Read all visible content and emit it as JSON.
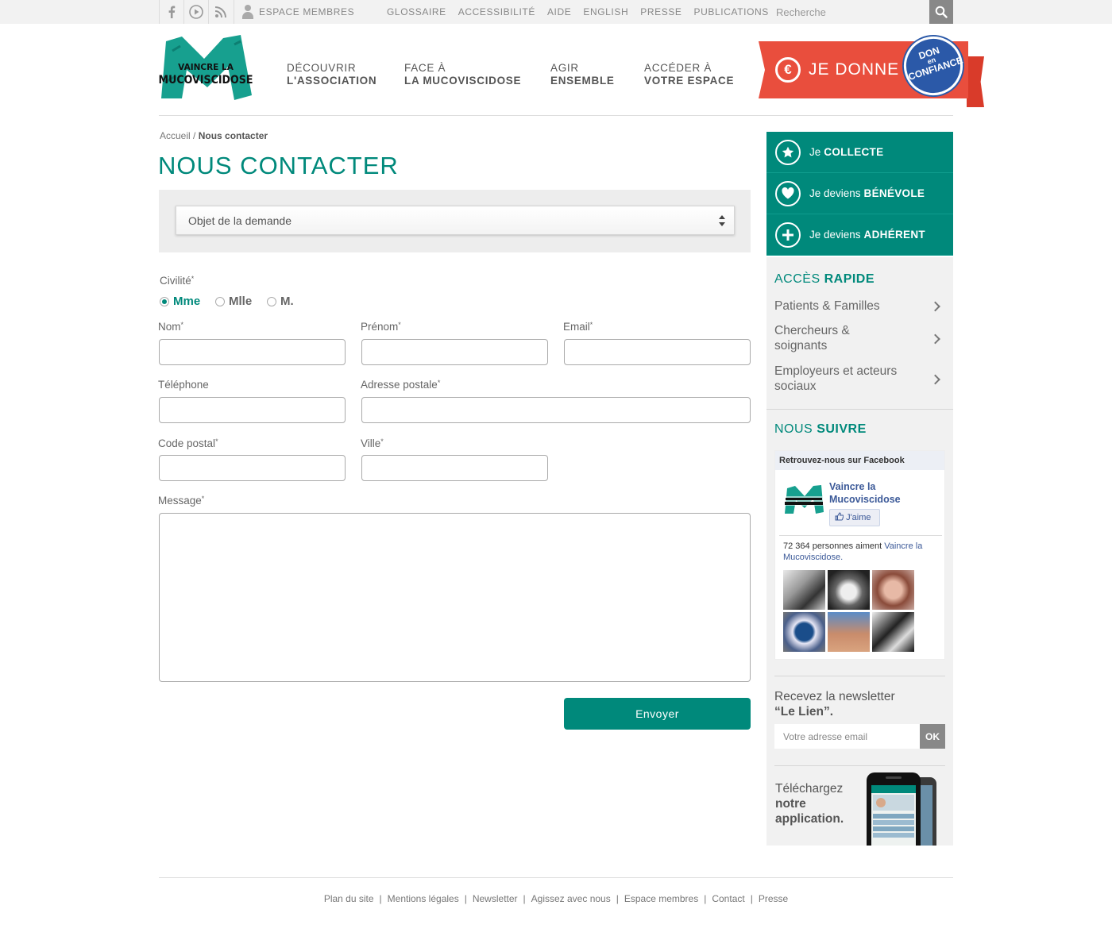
{
  "topbar": {
    "social_icons": [
      "facebook-icon",
      "play-icon",
      "rss-icon"
    ],
    "members_label": "ESPACE MEMBRES",
    "links": [
      "GLOSSAIRE",
      "ACCESSIBILITÉ",
      "AIDE",
      "ENGLISH",
      "PRESSE",
      "PUBLICATIONS"
    ],
    "search_placeholder": "Recherche"
  },
  "header": {
    "logo_text_1": "VAINCRE LA",
    "logo_text_2": "MUCOVISCIDOSE",
    "nav": [
      {
        "line1": "DÉCOUVRIR",
        "line2": "L'ASSOCIATION"
      },
      {
        "line1": "FACE À",
        "line2": "LA MUCOVISCIDOSE"
      },
      {
        "line1": "AGIR",
        "line2": "ENSEMBLE"
      },
      {
        "line1": "ACCÉDER À",
        "line2": "VOTRE ESPACE"
      }
    ],
    "donate_label": "JE DONNE",
    "seal": {
      "line1": "DON",
      "line2": "en",
      "line3": "CONFIANCE"
    }
  },
  "breadcrumb": {
    "home": "Accueil",
    "separator": "/",
    "current": "Nous contacter"
  },
  "page_title": "NOUS CONTACTER",
  "form": {
    "subject_select": "Objet de la demande",
    "civility_label": "Civilité",
    "civility_options": [
      "Mme",
      "Mlle",
      "M."
    ],
    "civility_selected": "Mme",
    "labels": {
      "nom": "Nom",
      "prenom": "Prénom",
      "email": "Email",
      "telephone": "Téléphone",
      "adresse": "Adresse postale",
      "code_postal": "Code postal",
      "ville": "Ville",
      "message": "Message"
    },
    "required_mark": "*",
    "submit_label": "Envoyer"
  },
  "sidebar": {
    "actions": [
      {
        "prefix": "Je",
        "bold": "COLLECTE",
        "icon": "star-icon"
      },
      {
        "prefix": "Je deviens",
        "bold": "BÉNÉVOLE",
        "icon": "heart-icon"
      },
      {
        "prefix": "Je deviens",
        "bold": "ADHÉRENT",
        "icon": "plus-icon"
      }
    ],
    "quick_access": {
      "title_1": "ACCÈS",
      "title_2": "RAPIDE",
      "items": [
        "Patients & Familles",
        "Chercheurs & soignants",
        "Employeurs et acteurs sociaux"
      ]
    },
    "follow": {
      "title_1": "NOUS",
      "title_2": "SUIVRE"
    },
    "facebook": {
      "header": "Retrouvez-nous sur Facebook",
      "page_name": "Vaincre la Mucoviscidose",
      "like_label": "J'aime",
      "count_text": "72 364 personnes aiment",
      "count_link": "Vaincre la Mucoviscidose."
    },
    "newsletter": {
      "line1": "Recevez la newsletter",
      "line2": "“Le Lien”.",
      "placeholder": "Votre adresse email",
      "ok_label": "OK"
    },
    "app": {
      "line1": "Téléchargez",
      "line2": "notre",
      "line3": "application."
    }
  },
  "footer": {
    "links": [
      "Plan du site",
      "Mentions légales",
      "Newsletter",
      "Agissez avec nous",
      "Espace membres",
      "Contact",
      "Presse"
    ],
    "separator": "|"
  },
  "colors": {
    "accent": "#00897b",
    "donate": "#e94e3d",
    "seal": "#2b59a8"
  }
}
